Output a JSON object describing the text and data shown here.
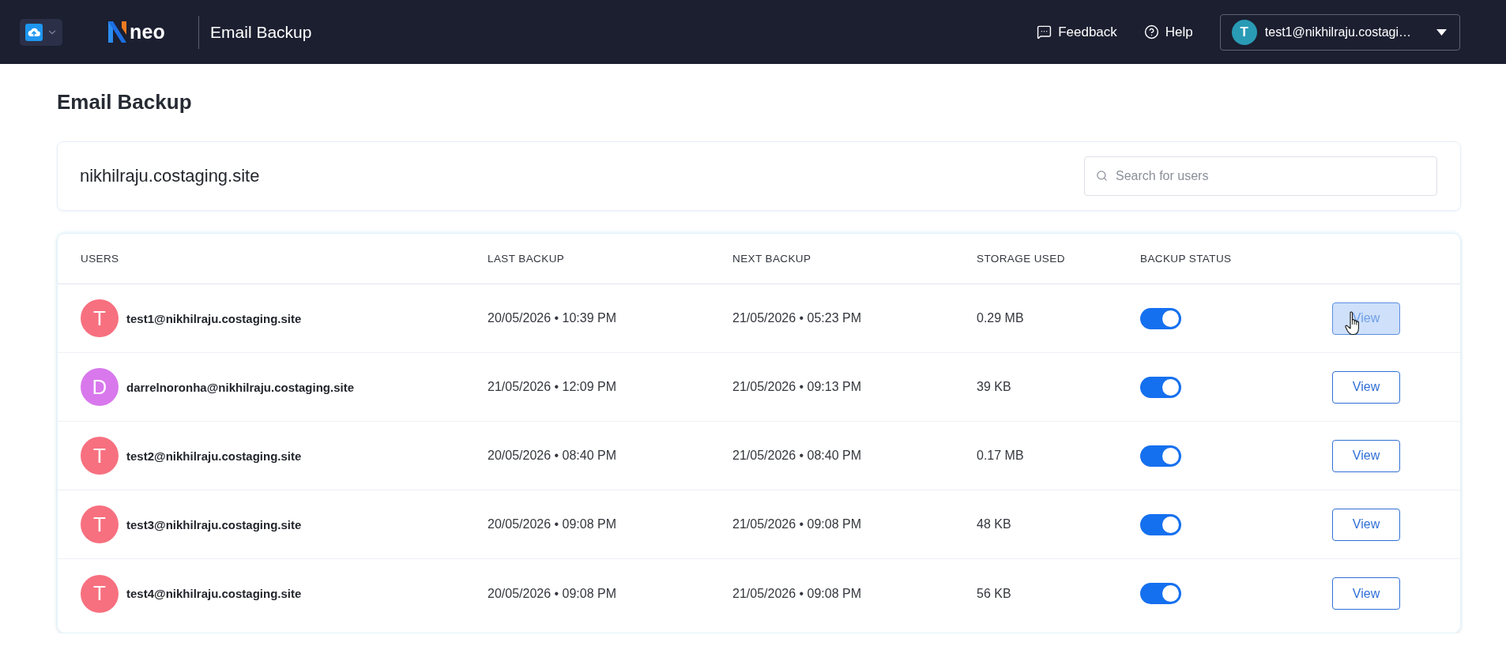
{
  "header": {
    "logo": {
      "text": "neo"
    },
    "app_title": "Email Backup",
    "actions": [
      {
        "kind": "feedback",
        "label": "Feedback"
      },
      {
        "kind": "help",
        "label": "Help"
      }
    ],
    "account": {
      "initial": "T",
      "email": "test1@nikhilraju.costagi…"
    }
  },
  "page": {
    "title": "Email Backup"
  },
  "domain_card": {
    "domain": "nikhilraju.costaging.site",
    "search": {
      "placeholder": "Search for users"
    }
  },
  "table": {
    "columns": [
      "USERS",
      "LAST BACKUP",
      "NEXT BACKUP",
      "STORAGE USED",
      "BACKUP STATUS"
    ],
    "rows": [
      {
        "initial": "T",
        "color": "#f7707f",
        "email": "test1@nikhilraju.costaging.site",
        "last_backup": "20/05/2026 • 10:39 PM",
        "next_backup": "21/05/2026 • 05:23 PM",
        "storage": "0.29 MB",
        "backup_on": true,
        "action": "View",
        "hovered": true
      },
      {
        "initial": "D",
        "color": "#d878ec",
        "email": "darrelnoronha@nikhilraju.costaging.site",
        "last_backup": "21/05/2026 • 12:09 PM",
        "next_backup": "21/05/2026 • 09:13 PM",
        "storage": "39 KB",
        "backup_on": true,
        "action": "View",
        "hovered": false
      },
      {
        "initial": "T",
        "color": "#f7707f",
        "email": "test2@nikhilraju.costaging.site",
        "last_backup": "20/05/2026 • 08:40 PM",
        "next_backup": "21/05/2026 • 08:40 PM",
        "storage": "0.17 MB",
        "backup_on": true,
        "action": "View",
        "hovered": false
      },
      {
        "initial": "T",
        "color": "#f7707f",
        "email": "test3@nikhilraju.costaging.site",
        "last_backup": "20/05/2026 • 09:08 PM",
        "next_backup": "21/05/2026 • 09:08 PM",
        "storage": "48 KB",
        "backup_on": true,
        "action": "View",
        "hovered": false
      },
      {
        "initial": "T",
        "color": "#f7707f",
        "email": "test4@nikhilraju.costaging.site",
        "last_backup": "20/05/2026 • 09:08 PM",
        "next_backup": "21/05/2026 • 09:08 PM",
        "storage": "56 KB",
        "backup_on": true,
        "action": "View",
        "hovered": false
      }
    ]
  }
}
